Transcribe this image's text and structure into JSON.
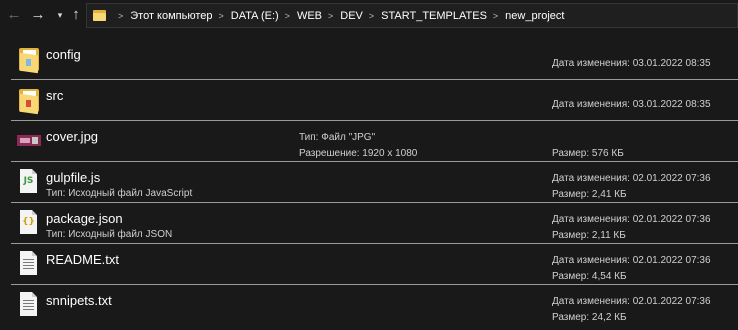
{
  "nav": {
    "back_icon": "arrow-left",
    "forward_icon": "arrow-right",
    "history_icon": "chevron-down",
    "up_icon": "arrow-up",
    "breadcrumb": [
      "Этот компьютер",
      "DATA (E:)",
      "WEB",
      "DEV",
      "START_TEMPLATES",
      "new_project"
    ]
  },
  "files": [
    {
      "name": "config",
      "type": "folder",
      "right1": "Дата изменения: 03.01.2022 08:35"
    },
    {
      "name": "src",
      "type": "folder",
      "right1": "Дата изменения: 03.01.2022 08:35"
    },
    {
      "name": "cover.jpg",
      "type": "image",
      "mid1": "Тип: Файл \"JPG\"",
      "mid2": "Разрешение: 1920 x 1080",
      "right2": "Размер: 576 КБ"
    },
    {
      "name": "gulpfile.js",
      "type": "js",
      "sub": "Тип: Исходный файл JavaScript",
      "right1": "Дата изменения: 02.01.2022 07:36",
      "right2": "Размер: 2,41 КБ"
    },
    {
      "name": "package.json",
      "type": "json",
      "sub": "Тип: Исходный файл JSON",
      "right1": "Дата изменения: 02.01.2022 07:36",
      "right2": "Размер: 2,11 КБ"
    },
    {
      "name": "README.txt",
      "type": "text",
      "right1": "Дата изменения: 02.01.2022 07:36",
      "right2": "Размер: 4,54 КБ"
    },
    {
      "name": "snnipets.txt",
      "type": "text",
      "right1": "Дата изменения: 02.01.2022 07:36",
      "right2": "Размер: 24,2 КБ"
    }
  ],
  "colors": {
    "background": "#191919",
    "divider": "#9a9a9a",
    "folder": "#f8d775",
    "js": "#3c9a3c",
    "json": "#c8a400"
  }
}
